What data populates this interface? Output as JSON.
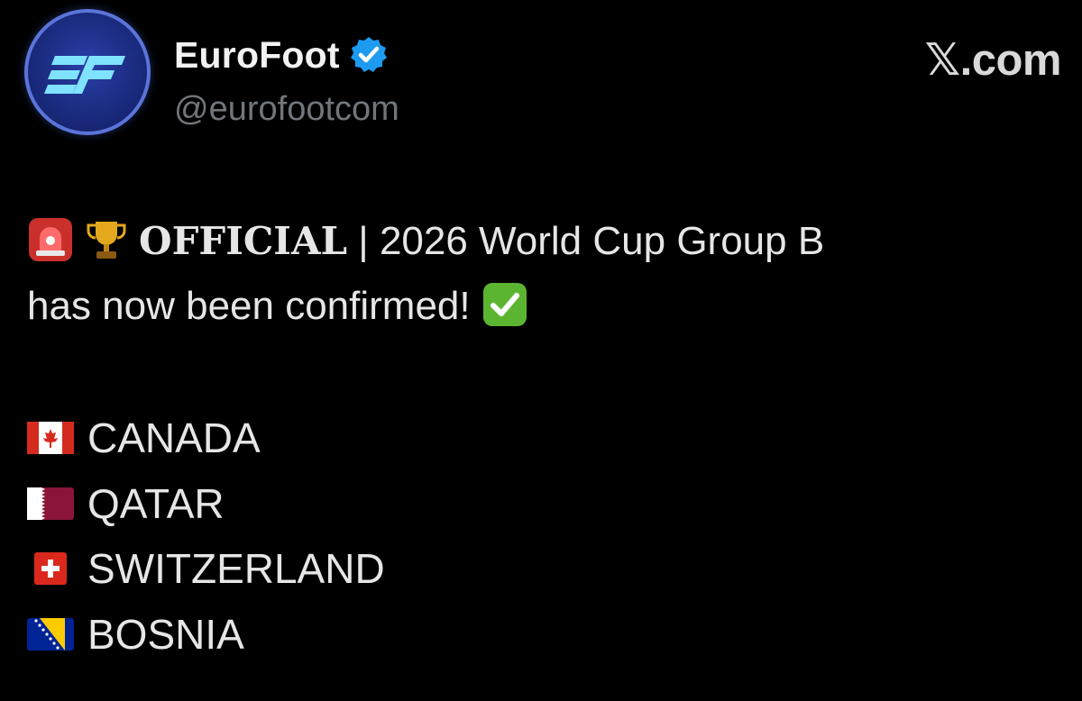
{
  "account": {
    "display_name": "EuroFoot",
    "handle": "@eurofootcom",
    "verified_icon": "verified-badge-icon",
    "avatar_text": "EF",
    "badge_color": "#1d9bf0"
  },
  "brand": {
    "site_x": "𝕏",
    "site_suffix": ".com"
  },
  "post": {
    "emojis_line1": [
      "siren-icon",
      "trophy-icon"
    ],
    "official_word": "OFFICIAL",
    "line1_rest": " | 2026 World Cup Group B",
    "line2": "has now been confirmed! ",
    "emoji_line2": "check-mark-icon"
  },
  "teams": [
    {
      "flag": "canada-flag-icon",
      "name": "CANADA"
    },
    {
      "flag": "qatar-flag-icon",
      "name": "QATAR"
    },
    {
      "flag": "switzerland-flag-icon",
      "name": "SWITZERLAND"
    },
    {
      "flag": "bosnia-flag-icon",
      "name": "BOSNIA"
    }
  ]
}
